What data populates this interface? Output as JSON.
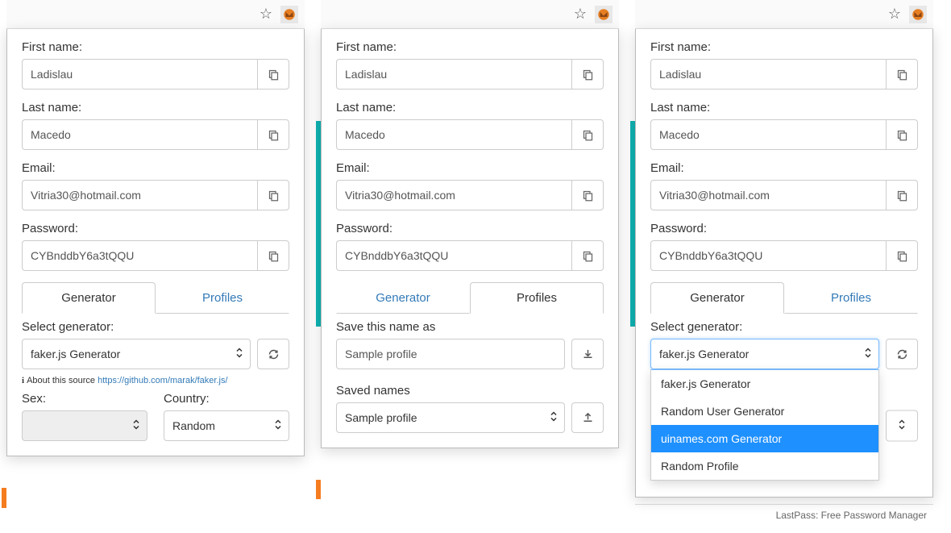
{
  "fields": {
    "first_name_label": "First name:",
    "first_name_value": "Ladislau",
    "last_name_label": "Last name:",
    "last_name_value": "Macedo",
    "email_label": "Email:",
    "email_value": "Vitria30@hotmail.com",
    "password_label": "Password:",
    "password_value": "CYBnddbY6a3tQQU"
  },
  "tabs": {
    "generator": "Generator",
    "profiles": "Profiles"
  },
  "panel1": {
    "select_generator_label": "Select generator:",
    "generator_value": "faker.js Generator",
    "about_prefix": "About this source ",
    "about_link": "https://github.com/marak/faker.js/",
    "sex_label": "Sex:",
    "country_label": "Country:",
    "country_value": "Random"
  },
  "panel2": {
    "save_name_label": "Save this name as",
    "save_name_value": "Sample profile",
    "saved_names_label": "Saved names",
    "saved_names_value": "Sample profile"
  },
  "panel3": {
    "select_generator_label": "Select generator:",
    "generator_value": "faker.js Generator",
    "dropdown": {
      "opt1": "faker.js Generator",
      "opt2": "Random User Generator",
      "opt3": "uinames.com Generator",
      "opt4": "Random Profile"
    },
    "footer_text": "LastPass: Free Password Manager"
  }
}
